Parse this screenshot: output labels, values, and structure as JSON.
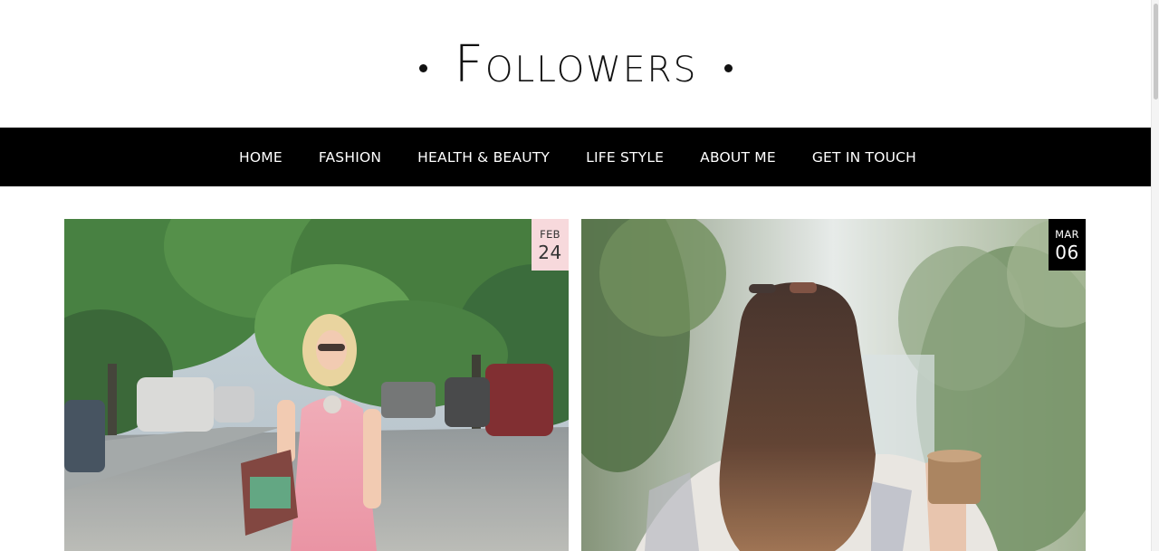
{
  "site": {
    "title": "Followers"
  },
  "nav": {
    "items": [
      {
        "label": "HOME"
      },
      {
        "label": "FASHION"
      },
      {
        "label": "HEALTH & BEAUTY"
      },
      {
        "label": "LIFE STYLE"
      },
      {
        "label": "ABOUT ME"
      },
      {
        "label": "GET IN TOUCH"
      }
    ]
  },
  "posts": [
    {
      "date": {
        "month": "FEB",
        "day": "24"
      },
      "badge_color": "#f7d9dc",
      "image": "woman-pink-dress-street-photo"
    },
    {
      "date": {
        "month": "MAR",
        "day": "06"
      },
      "badge_color": "#000000",
      "image": "woman-long-hair-coffee-cup-photo"
    }
  ],
  "colors": {
    "nav_background": "#000000",
    "nav_text": "#ffffff",
    "title_text": "#111111"
  }
}
